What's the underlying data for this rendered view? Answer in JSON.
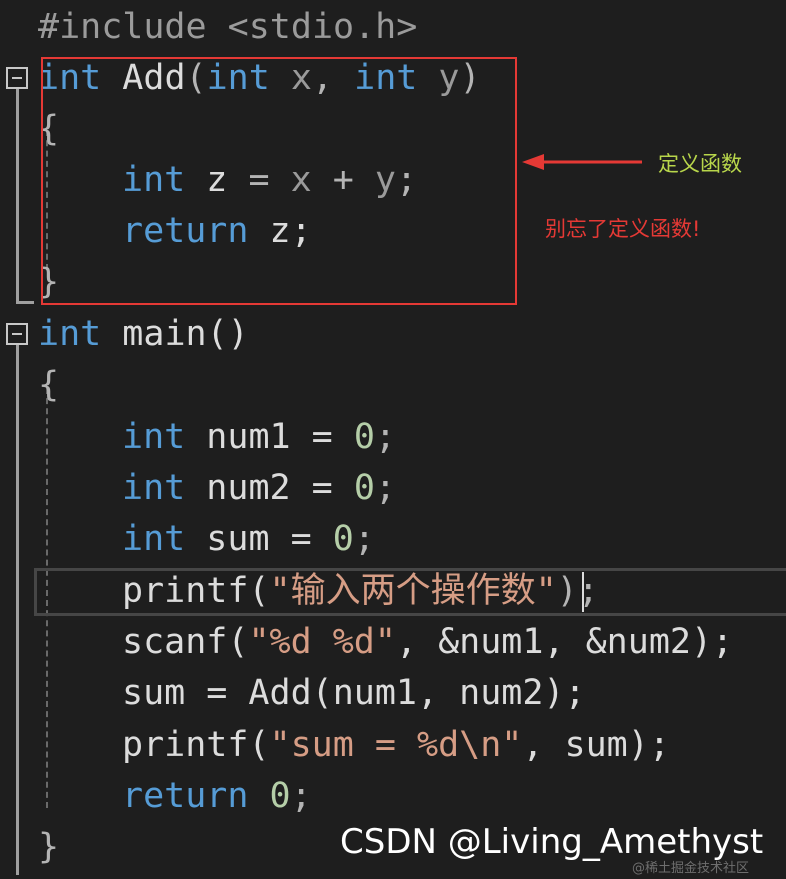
{
  "code": {
    "include": {
      "directive": "#include",
      "header": "<stdio.h>"
    },
    "add_func": {
      "ret_type": "int",
      "name": "Add",
      "open_paren": "(",
      "p1_type": "int",
      "p1_name": "x",
      "comma": ",",
      "p2_type": "int",
      "p2_name": "y",
      "close_paren": ")",
      "open_brace": "{",
      "decl_type": "int",
      "decl_var": "z",
      "assign": "=",
      "expr_a": "x",
      "plus": "+",
      "expr_b": "y",
      "semi": ";",
      "return_kw": "return",
      "return_val": "z;",
      "close_brace": "}"
    },
    "main_func": {
      "ret_type": "int",
      "name": "main()",
      "open_brace": "{",
      "l1_type": "int",
      "l1_rest": "num1 =",
      "l1_val": "0",
      "l2_type": "int",
      "l2_rest": "num2 =",
      "l2_val": "0",
      "l3_type": "int",
      "l3_rest": "sum =",
      "l3_val": "0",
      "semi": ";",
      "printf1_fn": "printf(",
      "printf1_str": "\"输入两个操作数\"",
      "printf1_end": ");",
      "scanf_fn": "scanf(",
      "scanf_str": "\"%d %d\"",
      "scanf_args": ", &num1, &num2);",
      "sum_line": "sum = Add(num1, num2);",
      "printf2_fn": "printf(",
      "printf2_str": "\"sum = %d\\n\"",
      "printf2_args": ", sum);",
      "return_kw": "return",
      "return_val": "0",
      "close_brace": "}"
    }
  },
  "annotations": {
    "green_note": "定义函数",
    "red_note": "别忘了定义函数!"
  },
  "watermark": {
    "main": "CSDN @Living_Amethyst",
    "small": "@稀土掘金技术社区"
  },
  "colors": {
    "keyword": "#569cd6",
    "string": "#d69d85",
    "number": "#b5cea8",
    "highlight_box": "#e53935",
    "green_note": "#b8d64b"
  }
}
